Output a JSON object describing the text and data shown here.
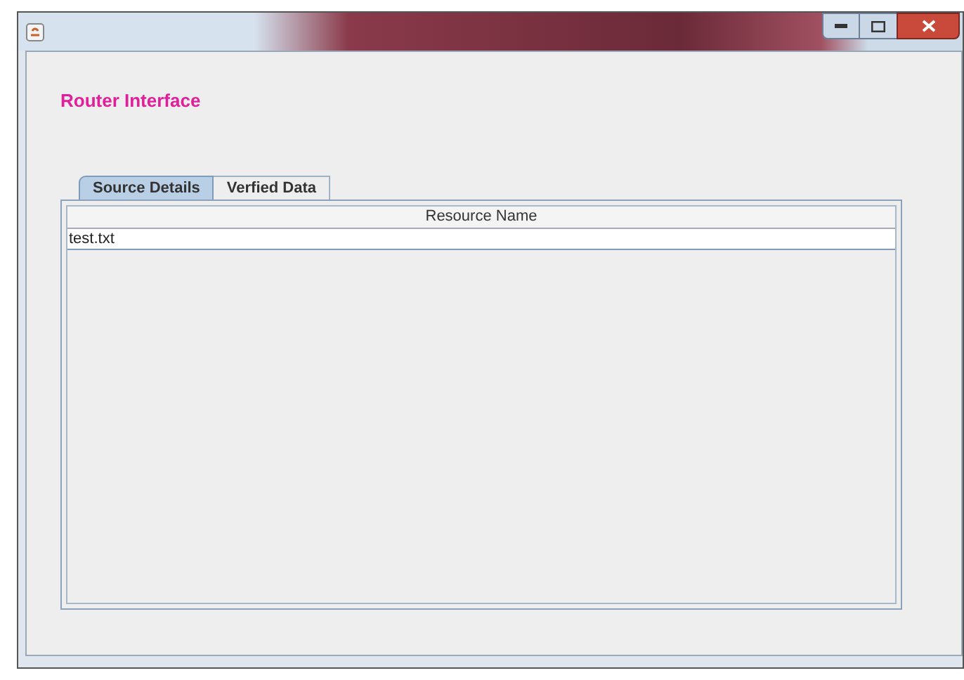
{
  "heading": "Router Interface",
  "tabs": [
    {
      "label": "Source Details",
      "selected": true
    },
    {
      "label": "Verfied Data",
      "selected": false
    }
  ],
  "table": {
    "columns": [
      "Resource Name"
    ],
    "rows": [
      {
        "cells": [
          "test.txt"
        ],
        "selected": false
      }
    ]
  }
}
